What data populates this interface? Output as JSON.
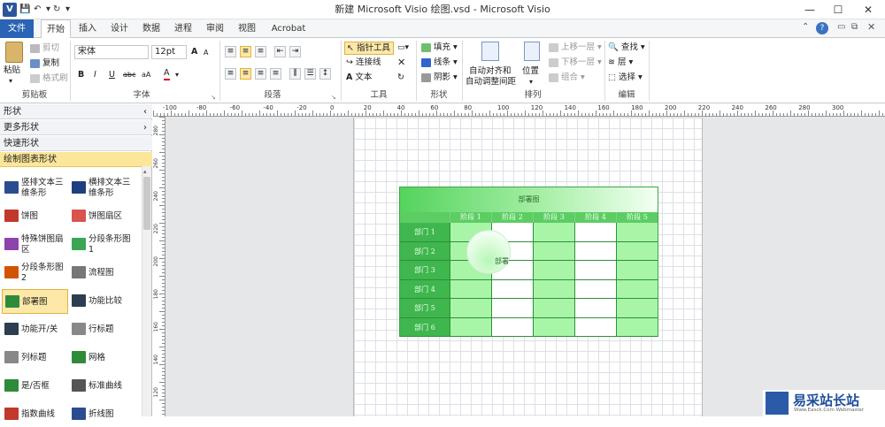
{
  "window": {
    "title": "新建 Microsoft Visio 绘图.vsd - Microsoft Visio",
    "logo": "V",
    "minimize": "—",
    "maximize": "☐",
    "close": "✕"
  },
  "tabs": [
    "文件",
    "开始",
    "插入",
    "设计",
    "数据",
    "进程",
    "审阅",
    "视图",
    "Acrobat"
  ],
  "ribbon": {
    "clipboard": {
      "paste": "粘贴",
      "cut": "剪切",
      "copy": "复制",
      "format_painter": "格式刷",
      "label": "剪贴板"
    },
    "font": {
      "name": "宋体",
      "size": "12pt",
      "grow": "A",
      "shrink": "A",
      "bold": "B",
      "italic": "I",
      "underline": "U",
      "strike": "abc",
      "case": "aA",
      "color": "A",
      "label": "字体"
    },
    "paragraph": {
      "label": "段落"
    },
    "tools": {
      "pointer": "指针工具",
      "connector": "连接线",
      "text": "文本",
      "label": "工具"
    },
    "shape": {
      "fill": "填充",
      "line": "线条",
      "shadow": "阴影",
      "label": "形状"
    },
    "arrange": {
      "auto_align_1": "自动对齐和",
      "auto_align_2": "自动调整间距",
      "position": "位置",
      "bring_forward": "上移一层",
      "send_backward": "下移一层",
      "group": "组合",
      "label": "排列"
    },
    "editing": {
      "find": "查找",
      "layer": "层",
      "select": "选择",
      "label": "编辑"
    }
  },
  "panel": {
    "headers": [
      "形状",
      "更多形状",
      "快速形状",
      "绘制图表形状"
    ],
    "shapes": [
      {
        "a": "竖排文本三",
        "b": "维条形",
        "color": "#2a4d8f"
      },
      {
        "a": "横排文本三",
        "b": "维条形",
        "color": "#1f3f7f"
      },
      {
        "a": "饼图",
        "b": "",
        "color": "#c0392b"
      },
      {
        "a": "饼图扇区",
        "b": "",
        "color": "#d9534f"
      },
      {
        "a": "特殊饼图扇",
        "b": "区",
        "color": "#8e44ad"
      },
      {
        "a": "分段条形图",
        "b": "1",
        "color": "#3aa655"
      },
      {
        "a": "分段条形图",
        "b": "2",
        "color": "#d35400"
      },
      {
        "a": "流程图",
        "b": "",
        "color": "#777777"
      },
      {
        "a": "部署图",
        "b": "",
        "color": "#2e8b3a"
      },
      {
        "a": "功能比较",
        "b": "",
        "color": "#2c3e50"
      },
      {
        "a": "功能开/关",
        "b": "",
        "color": "#2c3e50"
      },
      {
        "a": "行标题",
        "b": "",
        "color": "#888888"
      },
      {
        "a": "列标题",
        "b": "",
        "color": "#888888"
      },
      {
        "a": "网格",
        "b": "",
        "color": "#2e8b3a"
      },
      {
        "a": "是/否框",
        "b": "",
        "color": "#2e8b3a"
      },
      {
        "a": "标准曲线",
        "b": "",
        "color": "#555555"
      },
      {
        "a": "指数曲线",
        "b": "",
        "color": "#c0392b"
      },
      {
        "a": "折线图",
        "b": "",
        "color": "#2a4d8f"
      }
    ]
  },
  "ruler": {
    "h": [
      "-100",
      "-80",
      "-60",
      "-40",
      "-20",
      "0",
      "20",
      "40",
      "60",
      "80",
      "100",
      "120",
      "140",
      "160",
      "180",
      "200",
      "220",
      "240",
      "260",
      "280",
      "300"
    ],
    "v": [
      "280",
      "260",
      "240",
      "220",
      "200",
      "180",
      "160",
      "140",
      "120"
    ]
  },
  "diagram": {
    "title": "部署图",
    "columns": [
      "阶段 1",
      "阶段 2",
      "阶段 3",
      "阶段 4",
      "阶段 5"
    ],
    "rows": [
      "部门 1",
      "部门 2",
      "部门 3",
      "部门 4",
      "部门 5",
      "部门 6"
    ],
    "overlay_label": "部署",
    "colors": {
      "dark": "#3fb64e",
      "light": "#a8f5a8",
      "white": "#ffffff",
      "header": "#5ccd63"
    }
  },
  "watermark": {
    "title": "易采站长站",
    "sub": "Www.Easck.Com Webmaster"
  }
}
